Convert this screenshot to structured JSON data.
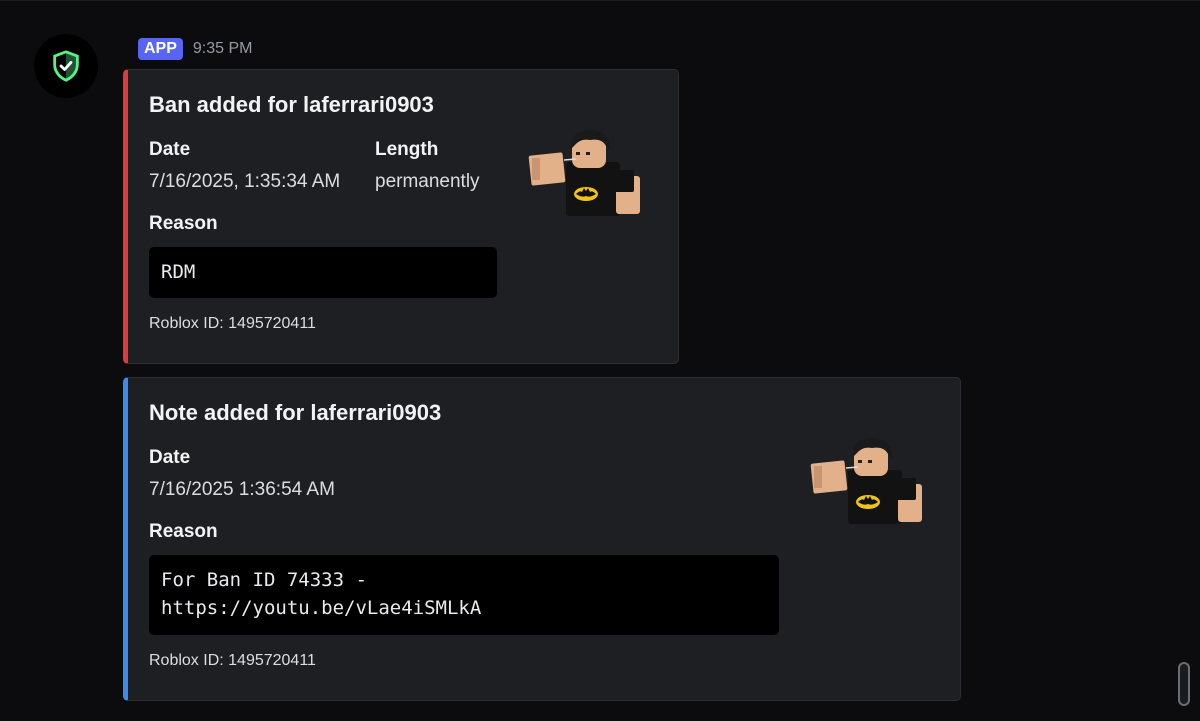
{
  "message": {
    "username": "",
    "badge": "APP",
    "timestamp": "9:35 PM",
    "avatar_icon": "shield-check-icon",
    "colors": {
      "badge": "#5865f2",
      "ban_accent": "#e03b3b",
      "note_accent": "#3b8ef0",
      "shield": "#57f287"
    }
  },
  "ban_embed": {
    "title": "Ban added for laferrari0903",
    "date_label": "Date",
    "date_value": "7/16/2025, 1:35:34 AM",
    "length_label": "Length",
    "length_value": "permanently",
    "reason_label": "Reason",
    "reason_value": "RDM",
    "footer": "Roblox ID: 1495720411",
    "thumbnail": "roblox-avatar-batman-shirt"
  },
  "note_embed": {
    "title": "Note added for laferrari0903",
    "date_label": "Date",
    "date_value": "7/16/2025 1:36:54 AM",
    "reason_label": "Reason",
    "reason_value": "For Ban ID 74333 -\nhttps://youtu.be/vLae4iSMLkA",
    "footer": "Roblox ID: 1495720411",
    "thumbnail": "roblox-avatar-batman-shirt"
  }
}
